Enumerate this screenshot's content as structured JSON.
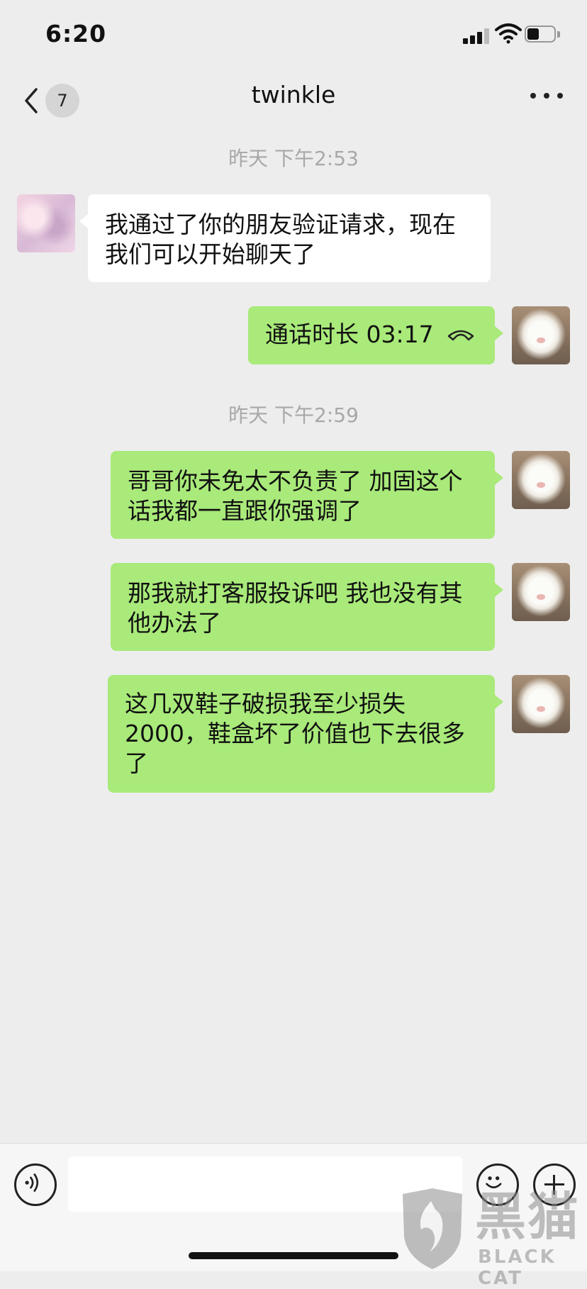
{
  "status_bar": {
    "time": "6:20",
    "icons": [
      "cellular-signal-icon",
      "wifi-icon",
      "battery-icon"
    ]
  },
  "nav": {
    "back_icon": "chevron-left-icon",
    "unread_count": "7",
    "title": "twinkle",
    "more_icon": "more-dots-icon"
  },
  "messages": [
    {
      "type": "timestamp",
      "text": "昨天 下午2:53"
    },
    {
      "type": "incoming",
      "text": "我通过了你的朋友验证请求，现在我们可以开始聊天了"
    },
    {
      "type": "outgoing-call",
      "text": "通话时长 03:17",
      "icon": "phone-hangup-icon"
    },
    {
      "type": "timestamp",
      "text": "昨天 下午2:59"
    },
    {
      "type": "outgoing",
      "text": "哥哥你未免太不负责了 加固这个话我都一直跟你强调了"
    },
    {
      "type": "outgoing",
      "text": "那我就打客服投诉吧 我也没有其他办法了"
    },
    {
      "type": "outgoing",
      "text": "这几双鞋子破损我至少损失2000，鞋盒坏了价值也下去很多了"
    }
  ],
  "input_bar": {
    "value": "",
    "icons": [
      "voice-icon",
      "emoji-icon",
      "plus-icon"
    ]
  },
  "watermark": {
    "cn": "黑猫",
    "en": "BLACK CAT"
  },
  "colors": {
    "background": "#ededed",
    "outgoing_bubble": "#a9ea7a",
    "incoming_bubble": "#ffffff",
    "timestamp_text": "#a8a8a8"
  }
}
